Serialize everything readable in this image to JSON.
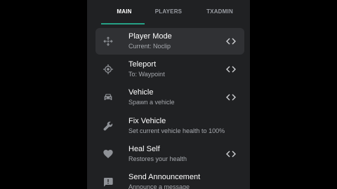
{
  "tabs": [
    {
      "label": "MAIN"
    },
    {
      "label": "PLAYERS"
    },
    {
      "label": "TXADMIN"
    }
  ],
  "menu": {
    "items": [
      {
        "title": "Player Mode",
        "subtitle": "Current: Noclip",
        "icon": "move-icon",
        "has_arrows": true
      },
      {
        "title": "Teleport",
        "subtitle": "To: Waypoint",
        "icon": "crosshair-icon",
        "has_arrows": true
      },
      {
        "title": "Vehicle",
        "subtitle": "Spawn a vehicle",
        "icon": "car-icon",
        "has_arrows": true
      },
      {
        "title": "Fix Vehicle",
        "subtitle": "Set current vehicle health to 100%",
        "icon": "wrench-icon",
        "has_arrows": false
      },
      {
        "title": "Heal Self",
        "subtitle": "Restores your health",
        "icon": "heart-icon",
        "has_arrows": true
      },
      {
        "title": "Send Announcement",
        "subtitle": "Announce a message",
        "icon": "announcement-icon",
        "has_arrows": false
      }
    ]
  },
  "colors": {
    "panel": "#202123",
    "selected": "#303134",
    "accent": "#25a086",
    "text": "#ffffff",
    "subtext": "#a6a9ae"
  }
}
